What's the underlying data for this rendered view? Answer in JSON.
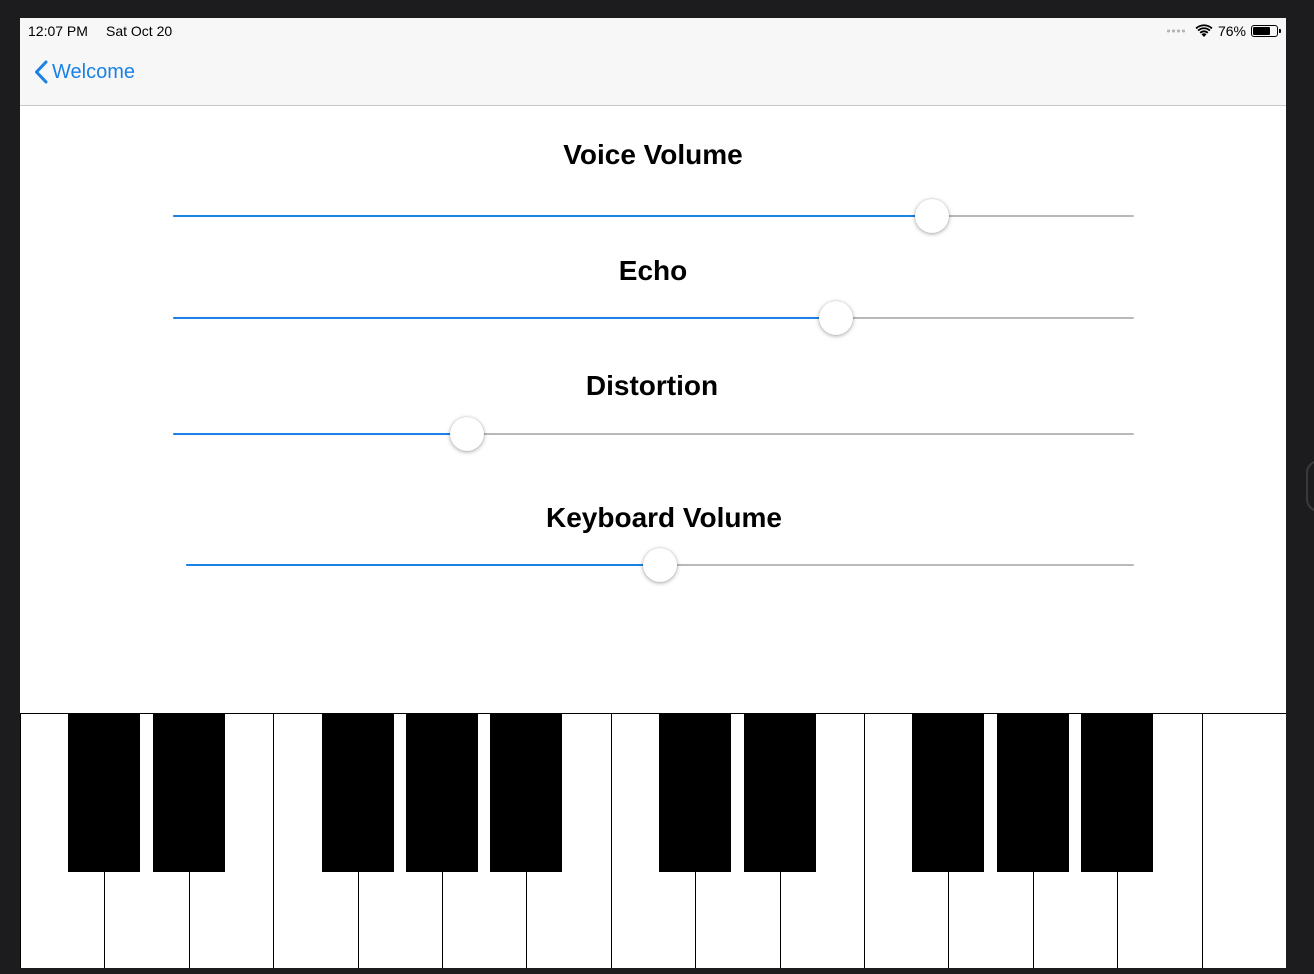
{
  "status_bar": {
    "time": "12:07 PM",
    "date": "Sat Oct 20",
    "battery_percent_label": "76%",
    "battery_level": 0.76
  },
  "nav": {
    "back_label": "Welcome"
  },
  "controls": [
    {
      "id": "voice-volume",
      "title": "Voice Volume",
      "value": 0.79
    },
    {
      "id": "echo",
      "title": "Echo",
      "value": 0.69
    },
    {
      "id": "distortion",
      "title": "Distortion",
      "value": 0.306
    },
    {
      "id": "keyboard-volume",
      "title": "Keyboard Volume",
      "value": 0.5
    }
  ],
  "keyboard": {
    "white_keys": 15,
    "black_key_positions": [
      0,
      1,
      3,
      4,
      5,
      7,
      8,
      10,
      11,
      12
    ]
  },
  "colors": {
    "accent": "#1a82e6",
    "track_inactive": "#b9b9b9",
    "bar_background": "#f7f7f7"
  },
  "icons": [
    "back-chevron-icon",
    "wifi-icon",
    "battery-icon",
    "cellular-signal-icon"
  ]
}
